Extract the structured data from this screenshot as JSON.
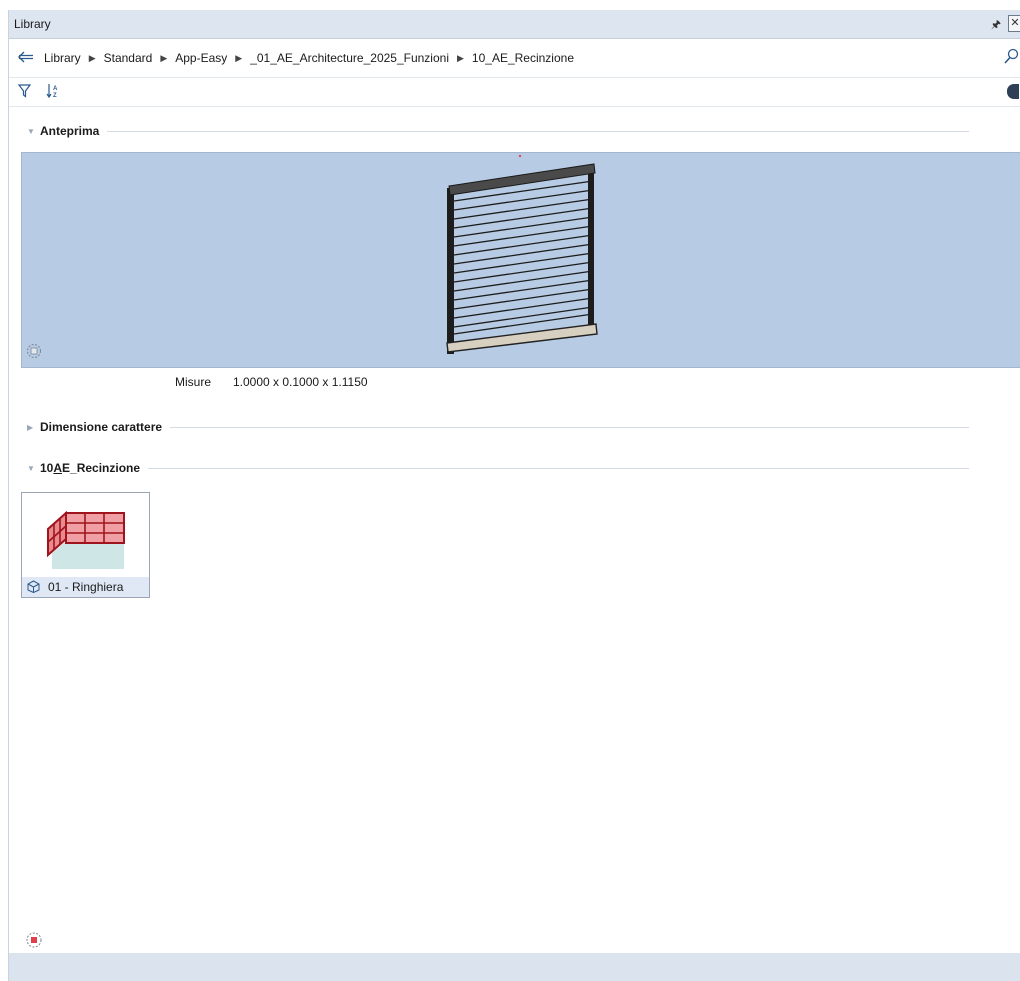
{
  "window": {
    "title": "Library"
  },
  "breadcrumb": [
    "Library",
    "Standard",
    "App-Easy",
    "_01_AE_Architecture_2025_Funzioni",
    "10_AE_Recinzione"
  ],
  "sections": {
    "preview": {
      "title": "Anteprima",
      "expanded": true
    },
    "text_size": {
      "title": "Dimensione carattere",
      "expanded": false
    },
    "folder": {
      "title_prefix": "10",
      "title_underlined": "A",
      "title_rest": "E_Recinzione",
      "expanded": true
    }
  },
  "properties": {
    "label": "Misure",
    "value": "1.0000 x 0.1000 x 1.1150"
  },
  "items": [
    {
      "label": "01 - Ringhiera",
      "icon": "railing-thumbnail"
    }
  ],
  "colors": {
    "titlebar": "#dde5f0",
    "preview_bg": "#b7cce4",
    "tile_footer": "#dfe8f4",
    "statusbar": "#dbe3ee",
    "thumbnail_red": "#e0525c"
  }
}
